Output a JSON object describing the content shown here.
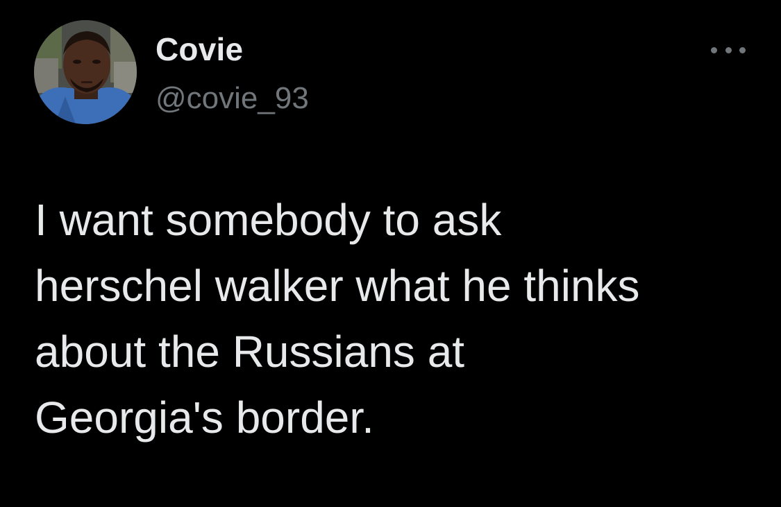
{
  "theme": {
    "background": "#000000",
    "text_primary": "#e7e9ea",
    "text_secondary": "#71767b"
  },
  "tweet": {
    "author": {
      "display_name": "Covie",
      "handle": "@covie_93",
      "avatar_icon": "profile-photo"
    },
    "more_icon": "more-horizontal-icon",
    "text_lines": [
      "I want somebody to ask",
      "herschel walker what he thinks",
      "about the Russians at",
      "Georgia's border."
    ]
  }
}
